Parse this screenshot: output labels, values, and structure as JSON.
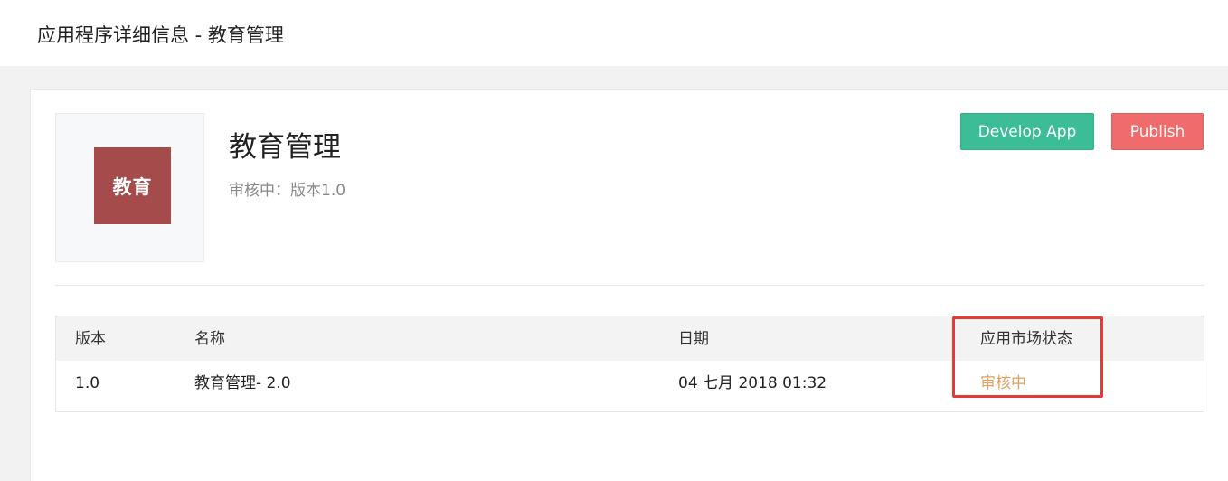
{
  "header": {
    "title": "应用程序详细信息 - 教育管理"
  },
  "app": {
    "logo_text": "教育",
    "logo_color": "#a54b4b",
    "name": "教育管理",
    "status_line": "审核中：版本1.0"
  },
  "actions": {
    "develop_label": "Develop App",
    "publish_label": "Publish",
    "develop_color": "#3dbd97",
    "publish_color": "#f06b6b"
  },
  "versions_table": {
    "columns": [
      "版本",
      "名称",
      "日期",
      "应用市场状态"
    ],
    "rows": [
      {
        "version": "1.0",
        "name": "教育管理- 2.0",
        "date": "04 七月 2018 01:32",
        "market_status": "审核中"
      }
    ]
  },
  "annotation": {
    "highlight_color": "#e53935"
  }
}
